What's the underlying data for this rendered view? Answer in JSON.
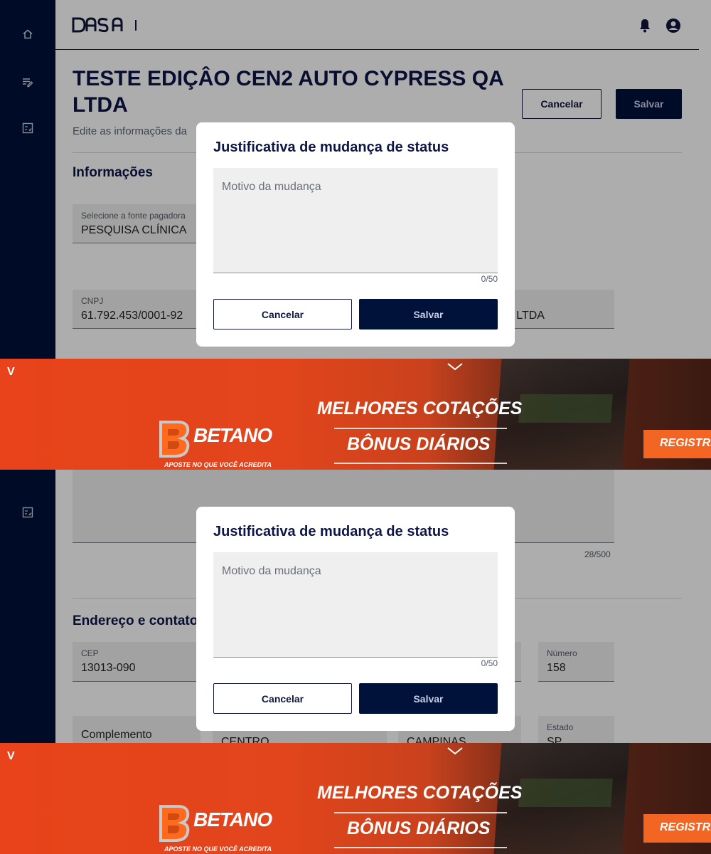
{
  "app": {
    "logo_text": "DASA",
    "title": "TESTE EDIÇÂO CEN2 AUTO CYPRESS QA LTDA",
    "subtitle": "Edite as informações da",
    "cancel_label": "Cancelar",
    "save_label": "Salvar",
    "section_info": "Informações",
    "section_address": "Endereço e contato"
  },
  "fields": {
    "fonte_label": "Selecione a fonte pagadora",
    "fonte_value": "PESQUISA CLÍNICA",
    "cnpj_label": "CNPJ",
    "cnpj_value": "61.792.453/0001-92",
    "razao_value_partial": "A LTDA",
    "obs_counter": "28/500",
    "cep_label": "CEP",
    "cep_value": "13013-090",
    "numero_label": "Número",
    "numero_value": "158",
    "complemento_placeholder": "Complemento",
    "bairro_value": "CENTRO",
    "cidade_value": "CAMPINAS",
    "estado_label": "Estado",
    "estado_value": "SP"
  },
  "modal": {
    "title": "Justificativa de mudança de status",
    "placeholder": "Motivo da mudança",
    "counter": "0/50",
    "cancel_label": "Cancelar",
    "save_label": "Salvar"
  },
  "ad": {
    "corner_mark": "V",
    "brand": "BETANO",
    "tagline": "APOSTE NO QUE VOCÊ ACREDITA",
    "headline1": "MELHORES COTAÇÕES",
    "headline2": "BÔNUS DIÁRIOS",
    "cta": "REGISTRE"
  },
  "colors": {
    "sidebar": "#00123a",
    "primary": "#00123a",
    "ad_orange": "#e8431a"
  }
}
